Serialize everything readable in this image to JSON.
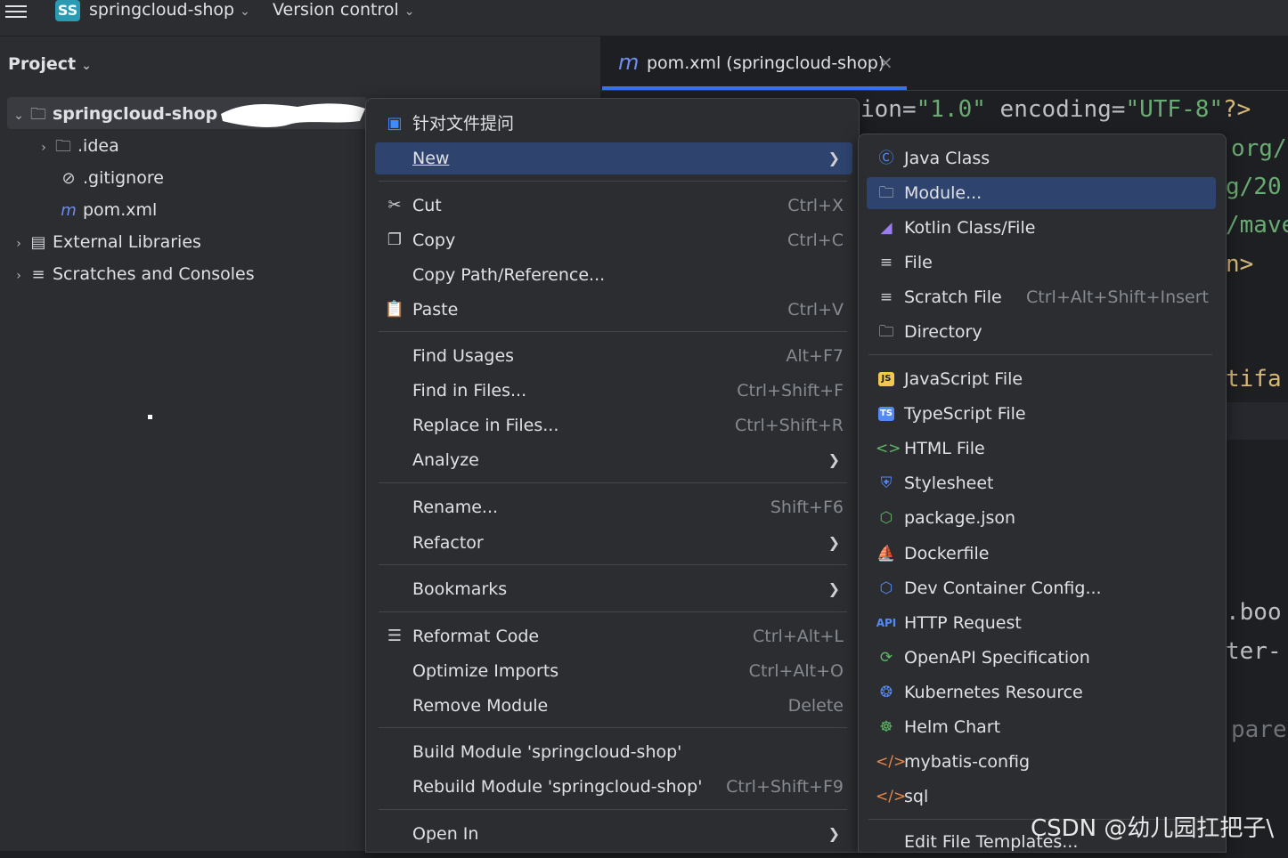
{
  "topbar": {
    "project_badge": "SS",
    "project_name": "springcloud-shop",
    "vcs": "Version control"
  },
  "project_panel": {
    "title": "Project",
    "tree": [
      {
        "label": "springcloud-shop",
        "icon": "module-folder-icon",
        "expanded": true
      },
      {
        "label": ".idea",
        "icon": "folder-icon"
      },
      {
        "label": ".gitignore",
        "icon": "ignore-icon"
      },
      {
        "label": "pom.xml",
        "icon": "maven-icon"
      },
      {
        "label": "External Libraries",
        "icon": "libraries-icon"
      },
      {
        "label": "Scratches and Consoles",
        "icon": "scratches-icon"
      }
    ]
  },
  "editor": {
    "tab": {
      "icon_glyph": "m",
      "label": "pom.xml (springcloud-shop)",
      "close": "×"
    },
    "code_fragments": [
      {
        "a": "ion=",
        "b": "\"1.0\"",
        "c": " encoding=",
        "d": "\"UTF-8\"",
        "e": "?>"
      },
      {
        "text": "org/"
      },
      {
        "text": "g/20"
      },
      {
        "text": "/mave"
      },
      {
        "text": "n>"
      },
      {
        "text": "tifa"
      },
      {
        "text": ".boo"
      },
      {
        "text": "ter-"
      },
      {
        "text": "pare"
      }
    ]
  },
  "context_menu": {
    "items": [
      {
        "label": "针对文件提问",
        "icon": "ai-assistant-icon"
      },
      {
        "label": "New",
        "submenu": true
      },
      {
        "label": "Cut",
        "shortcut": "Ctrl+X",
        "icon": "scissors-icon"
      },
      {
        "label": "Copy",
        "shortcut": "Ctrl+C",
        "icon": "copy-icon"
      },
      {
        "label": "Copy Path/Reference..."
      },
      {
        "label": "Paste",
        "shortcut": "Ctrl+V",
        "icon": "paste-icon"
      },
      {
        "label": "Find Usages",
        "shortcut": "Alt+F7"
      },
      {
        "label": "Find in Files...",
        "shortcut": "Ctrl+Shift+F"
      },
      {
        "label": "Replace in Files...",
        "shortcut": "Ctrl+Shift+R"
      },
      {
        "label": "Analyze",
        "submenu": true
      },
      {
        "label": "Rename...",
        "shortcut": "Shift+F6"
      },
      {
        "label": "Refactor",
        "submenu": true
      },
      {
        "label": "Bookmarks",
        "submenu": true
      },
      {
        "label": "Reformat Code",
        "shortcut": "Ctrl+Alt+L",
        "icon": "reformat-icon"
      },
      {
        "label": "Optimize Imports",
        "shortcut": "Ctrl+Alt+O"
      },
      {
        "label": "Remove Module",
        "shortcut": "Delete"
      },
      {
        "label": "Build Module 'springcloud-shop'"
      },
      {
        "label": "Rebuild Module 'springcloud-shop'",
        "shortcut": "Ctrl+Shift+F9"
      },
      {
        "label": "Open In",
        "submenu": true
      }
    ]
  },
  "new_submenu": {
    "items": [
      {
        "label": "Java Class",
        "icon": "java-class-icon"
      },
      {
        "label": "Module...",
        "icon": "module-icon",
        "selected": true
      },
      {
        "label": "Kotlin Class/File",
        "icon": "kotlin-icon"
      },
      {
        "label": "File",
        "icon": "file-icon"
      },
      {
        "label": "Scratch File",
        "shortcut": "Ctrl+Alt+Shift+Insert",
        "icon": "scratch-file-icon"
      },
      {
        "label": "Directory",
        "icon": "directory-icon"
      },
      {
        "label": "JavaScript File",
        "icon": "javascript-icon",
        "badge": "JS"
      },
      {
        "label": "TypeScript File",
        "icon": "typescript-icon",
        "badge": "TS"
      },
      {
        "label": "HTML File",
        "icon": "html-icon"
      },
      {
        "label": "Stylesheet",
        "icon": "css-icon"
      },
      {
        "label": "package.json",
        "icon": "nodejs-icon"
      },
      {
        "label": "Dockerfile",
        "icon": "docker-icon"
      },
      {
        "label": "Dev Container Config...",
        "icon": "dev-container-icon"
      },
      {
        "label": "HTTP Request",
        "icon": "api-icon",
        "badge": "API"
      },
      {
        "label": "OpenAPI Specification",
        "icon": "openapi-icon"
      },
      {
        "label": "Kubernetes Resource",
        "icon": "kubernetes-icon"
      },
      {
        "label": "Helm Chart",
        "icon": "helm-icon"
      },
      {
        "label": "mybatis-config",
        "icon": "xml-tag-icon"
      },
      {
        "label": "sql",
        "icon": "xml-tag-icon"
      },
      {
        "label": "Edit File Templates..."
      }
    ]
  },
  "watermark": "CSDN @幼儿园扛把子\\",
  "colors": {
    "selection": "#2e436e",
    "tab_accent": "#3574f0",
    "badge_teal": "#2a9bb3"
  }
}
